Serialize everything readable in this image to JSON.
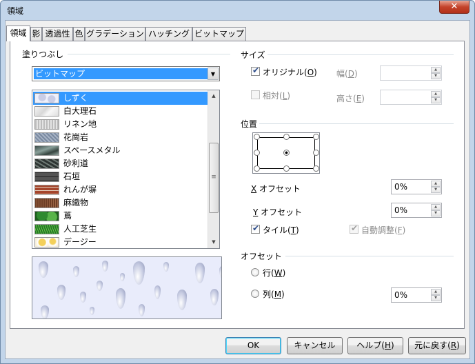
{
  "window": {
    "title": "領域",
    "close_glyph": "✕"
  },
  "tabs": [
    {
      "label": "領域",
      "active": true
    },
    {
      "label": "影"
    },
    {
      "label": "透過性"
    },
    {
      "label": "色"
    },
    {
      "label": "グラデーション"
    },
    {
      "label": "ハッチング"
    },
    {
      "label": "ビットマップ"
    }
  ],
  "fill": {
    "group_label": "塗りつぶし",
    "type_selected": "ビットマップ",
    "bitmaps": [
      {
        "label": "しずく",
        "selected": true
      },
      {
        "label": "白大理石"
      },
      {
        "label": "リネン地"
      },
      {
        "label": "花崗岩"
      },
      {
        "label": "スペースメタル"
      },
      {
        "label": "砂利道"
      },
      {
        "label": "石垣"
      },
      {
        "label": "れんが塀"
      },
      {
        "label": "麻織物"
      },
      {
        "label": "蔦"
      },
      {
        "label": "人工芝生"
      },
      {
        "label": "デージー"
      }
    ]
  },
  "size": {
    "group_label": "サイズ",
    "original_label": "オリジナル(",
    "original_key": "O",
    "original_checked": true,
    "relative_label": "相対(",
    "relative_key": "L",
    "relative_checked": false,
    "width_label": "幅(",
    "width_key": "D",
    "width_value": "",
    "height_label": "高さ(",
    "height_key": "E",
    "height_value": ""
  },
  "position": {
    "group_label": "位置",
    "x_offset_key": "X",
    "x_offset_label": " オフセット",
    "x_offset_value": "0%",
    "y_offset_key": "Y",
    "y_offset_label": " オフセット",
    "y_offset_value": "0%",
    "tile_label": "タイル(",
    "tile_key": "T",
    "tile_checked": true,
    "autofit_label": "自動調整(",
    "autofit_key": "F",
    "autofit_checked": true
  },
  "offset": {
    "group_label": "オフセット",
    "row_label": "行(",
    "row_key": "W",
    "col_label": "列(",
    "col_key": "M",
    "value": "0%"
  },
  "buttons": {
    "ok": "OK",
    "cancel": "キャンセル",
    "help_label": "ヘルプ(",
    "help_key": "H",
    "reset_label": "元に戻す(",
    "reset_key": "R"
  },
  "close_paren": ")"
}
